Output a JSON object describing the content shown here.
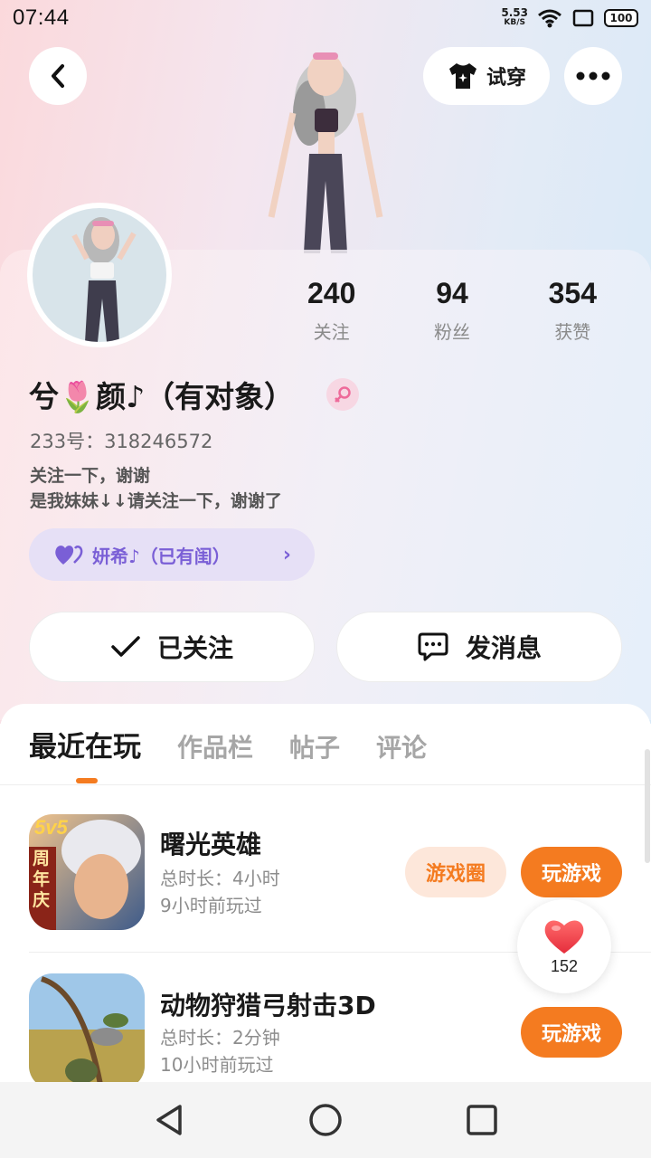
{
  "status_bar": {
    "time": "07:44",
    "net_speed_value": "5.53",
    "net_speed_unit": "KB/S",
    "battery": "100"
  },
  "header": {
    "back_icon": "chevron-left-icon",
    "try_on_label": "试穿",
    "more_icon": "more-dots-icon"
  },
  "profile": {
    "nickname": "兮🌷颜♪（有对象）",
    "gender_icon": "female-icon",
    "uid": "233号：318246572",
    "bio_line1": "关注一下，谢谢",
    "bio_line2": "是我妹妹↓↓请关注一下，谢谢了",
    "partner_label": "妍希♪（已有闺）",
    "stats": [
      {
        "value": "240",
        "label": "关注"
      },
      {
        "value": "94",
        "label": "粉丝"
      },
      {
        "value": "354",
        "label": "获赞"
      }
    ]
  },
  "actions": {
    "follow_label": "已关注",
    "message_label": "发消息"
  },
  "tabs": [
    {
      "label": "最近在玩",
      "active": true
    },
    {
      "label": "作品栏",
      "active": false
    },
    {
      "label": "帖子",
      "active": false
    },
    {
      "label": "评论",
      "active": false
    }
  ],
  "games": [
    {
      "title": "曙光英雄",
      "duration": "总时长：4小时",
      "last_played": "9小时前玩过",
      "circle_label": "游戏圈",
      "play_label": "玩游戏",
      "icon_badge_top": "5v5",
      "icon_badge_side": "周年庆"
    },
    {
      "title": "动物狩猎弓射击3D",
      "duration": "总时长：2分钟",
      "last_played": "10小时前玩过",
      "play_label": "玩游戏"
    }
  ],
  "like_float": {
    "icon": "heart-icon",
    "count": "152"
  },
  "colors": {
    "accent": "#f47b20",
    "partner_chip_bg": "#e6e0f6",
    "partner_chip_text": "#7a5fd6",
    "gender_badge": "#ee6a9a"
  }
}
